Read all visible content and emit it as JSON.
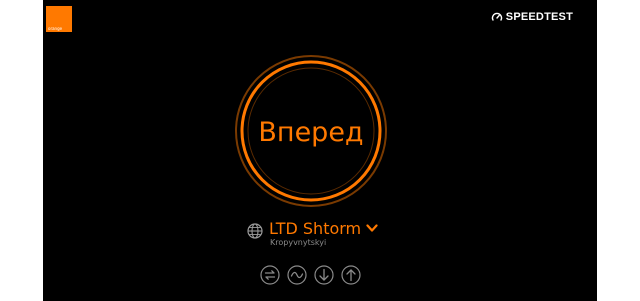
{
  "header": {
    "logo_text": "orange",
    "brand_label": "SPEEDTEST"
  },
  "main": {
    "go_label": "Вперед",
    "server": {
      "name": "LTD Shtorm",
      "location": "Kropyvnytskyi"
    },
    "metrics": [
      "ping-icon",
      "jitter-icon",
      "download-icon",
      "upload-icon"
    ]
  },
  "colors": {
    "accent": "#ff7900",
    "background": "#000000",
    "icon_gray": "#8a8a8a"
  }
}
